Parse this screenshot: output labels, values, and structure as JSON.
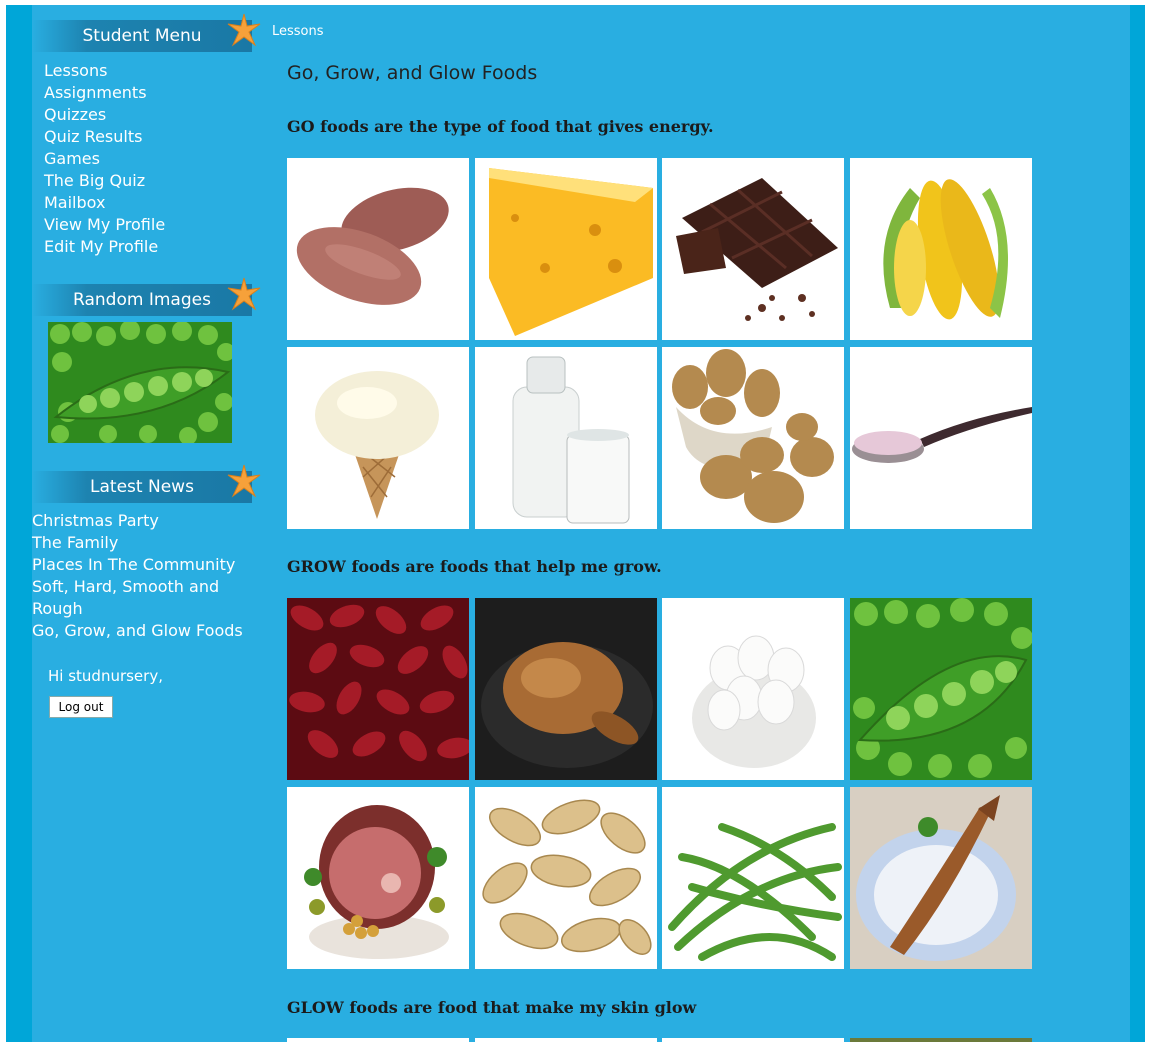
{
  "breadcrumb": "Lessons",
  "sidebar": {
    "student_menu_title": "Student Menu",
    "menu_items": [
      {
        "label": "Lessons"
      },
      {
        "label": "Assignments"
      },
      {
        "label": "Quizzes"
      },
      {
        "label": "Quiz Results"
      },
      {
        "label": "Games"
      },
      {
        "label": "The Big Quiz"
      },
      {
        "label": "Mailbox"
      },
      {
        "label": "View My Profile"
      },
      {
        "label": "Edit My Profile"
      }
    ],
    "random_images_title": "Random Images",
    "random_image_icon": "peas-pod-image",
    "latest_news_title": "Latest News",
    "news_items": [
      {
        "label": "Christmas Party"
      },
      {
        "label": "The Family"
      },
      {
        "label": "Places In The Community"
      },
      {
        "label": "Soft, Hard, Smooth and Rough"
      },
      {
        "label": "Go, Grow, and Glow Foods"
      }
    ],
    "greeting": "Hi studnursery,",
    "logout_label": "Log out"
  },
  "main": {
    "title": "Go, Grow, and Glow Foods",
    "sections": [
      {
        "heading": "GO foods are the type of food that gives energy.",
        "images": [
          "sweet-potato-image",
          "cheese-image",
          "chocolate-image",
          "corn-image",
          "ice-cream-image",
          "milk-image",
          "potatoes-image",
          "sugar-spoon-image"
        ]
      },
      {
        "heading": "GROW foods are foods that help me grow.",
        "images": [
          "kidney-beans-image",
          "roast-chicken-image",
          "eggs-image",
          "peas-image",
          "ham-image",
          "peanuts-image",
          "green-beans-image",
          "fish-image"
        ]
      },
      {
        "heading": "GLOW foods are food that make my skin glow"
      }
    ]
  },
  "colors": {
    "page_background": "#29aee1",
    "outer_border": "#00a6d8",
    "header_bar": "#1a78a5",
    "star": "#f6a13a",
    "link_text": "#ffffff"
  }
}
